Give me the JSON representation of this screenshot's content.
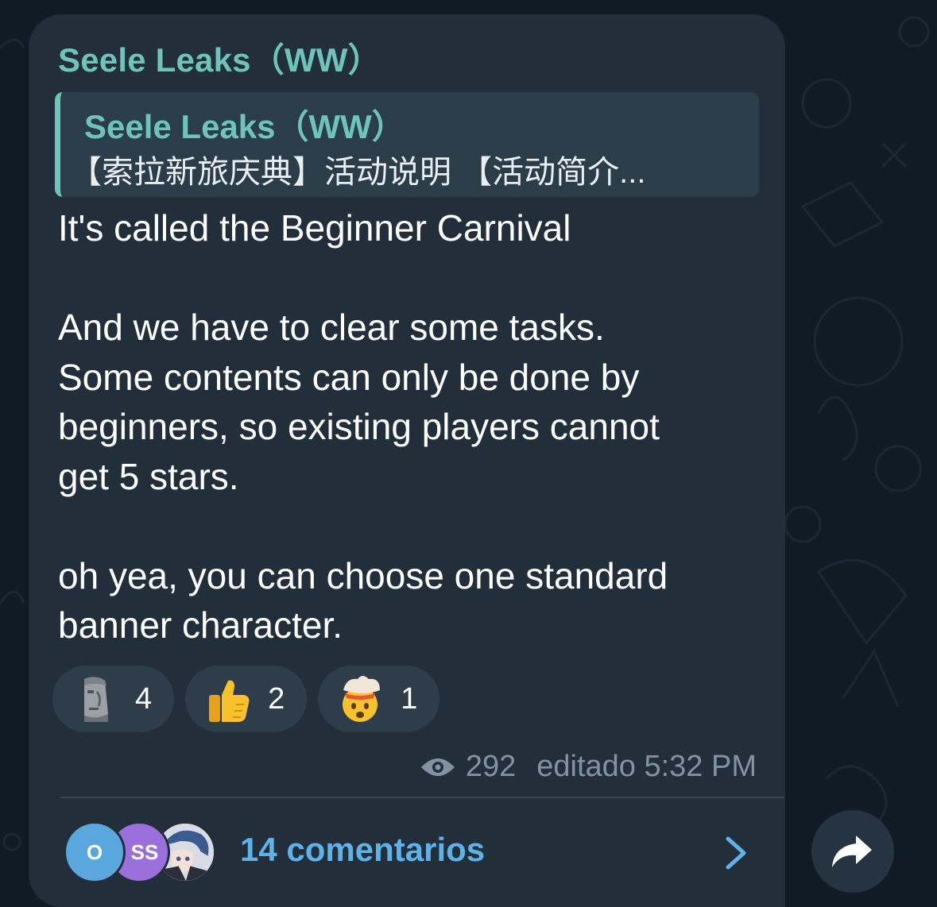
{
  "message": {
    "sender": "Seele Leaks（WW）",
    "reply": {
      "sender": "Seele Leaks（WW）",
      "preview": "【索拉新旅庆典】活动说明 【活动简介..."
    },
    "paragraphs": [
      [
        "It's called the Beginner Carnival"
      ],
      [
        "And we have to clear some tasks.",
        "Some contents can only be done by",
        "beginners, so existing players cannot",
        "get 5 stars."
      ],
      [
        "oh yea, you can choose one standard",
        "banner character."
      ]
    ],
    "reactions": [
      {
        "icon": "moai-icon",
        "count": "4"
      },
      {
        "icon": "thumbs-up-icon",
        "count": "2"
      },
      {
        "icon": "exploding-head-icon",
        "count": "1"
      }
    ],
    "views": "292",
    "edited_time": "editado 5:32 PM",
    "comments": {
      "label": "14 comentarios",
      "avatars": [
        {
          "initials": "O",
          "color": "#5aa7de"
        },
        {
          "initials": "SS",
          "color": "#9b6fdc"
        },
        {
          "initials": "",
          "color": "#c8ccd8"
        }
      ]
    }
  },
  "colors": {
    "accent_green": "#6ec4b8",
    "link_blue": "#5fb2e8",
    "bubble": "#222e3a",
    "background": "#111b26"
  }
}
